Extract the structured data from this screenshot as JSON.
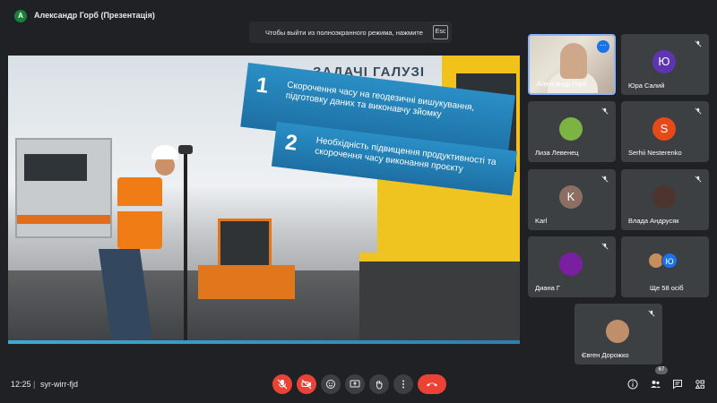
{
  "header": {
    "presenter_initial": "A",
    "title": "Александр Горб (Презентація)"
  },
  "toast": {
    "text": "Чтобы выйти из полноэкранного режима, нажмите",
    "key": "Esc"
  },
  "slide": {
    "heading": "ЗАДАЧІ ГАЛУЗІ",
    "items": [
      {
        "num": "1",
        "text": "Скорочення часу на геодезичні вишукування, підготовку даних та виконавчу зйомку"
      },
      {
        "num": "2",
        "text": "Необхідність підвищення продуктивності та скорочення часу виконання проєкту"
      }
    ]
  },
  "participants": [
    {
      "name": "Александр Горб",
      "type": "camera",
      "highlighted": true
    },
    {
      "name": "Юра Салий",
      "type": "initial",
      "initial": "Ю",
      "color": "#5e35b1",
      "muted": true
    },
    {
      "name": "Лиза Левенец",
      "type": "photo",
      "color": "#7cb342",
      "muted": true
    },
    {
      "name": "Serhii Nesterenko",
      "type": "initial",
      "initial": "S",
      "color": "#e64a19",
      "muted": true
    },
    {
      "name": "Karl",
      "type": "initial",
      "initial": "K",
      "color": "#8d6e63",
      "muted": true
    },
    {
      "name": "Влада Андрусяк",
      "type": "photo",
      "color": "#4e342e",
      "muted": true
    },
    {
      "name": "Диана Г",
      "type": "photo",
      "color": "#7b1fa2",
      "muted": true
    },
    {
      "name": "Ще 58 осіб",
      "type": "group",
      "initial": "Ю",
      "color": "#1a73e8"
    },
    {
      "name": "Євген Дорожко",
      "type": "photo",
      "color": "#bf8f6a",
      "muted": true
    }
  ],
  "bottombar": {
    "time": "12:25",
    "separator": "|",
    "meeting_code": "syr-wirr-fjd",
    "participant_count": "67"
  },
  "colors": {
    "background": "#202124",
    "tile": "#3c4043",
    "danger": "#ea4335",
    "accent": "#1a73e8"
  }
}
